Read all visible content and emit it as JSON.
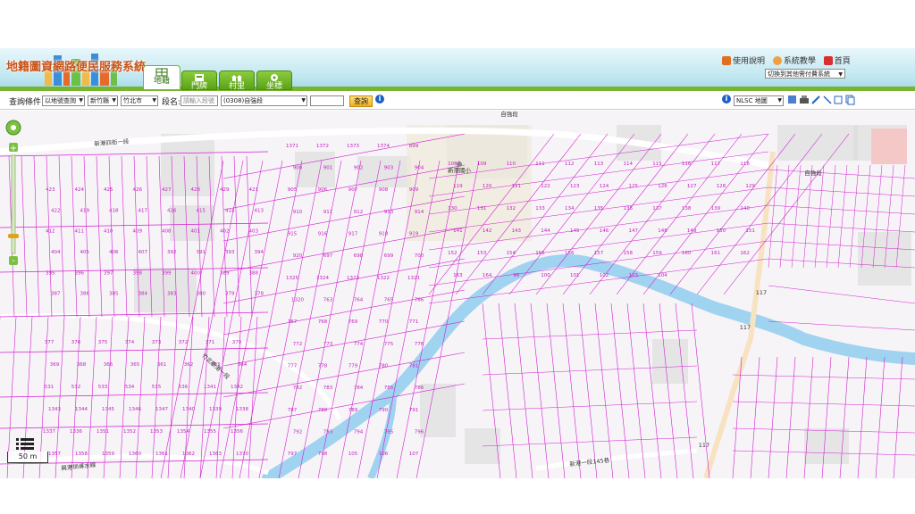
{
  "header": {
    "app_title": "地籍圖資網路便民服務系統",
    "tabs": [
      {
        "label": "地籍",
        "icon": "land-icon",
        "active": true
      },
      {
        "label": "門牌",
        "icon": "doorplate-icon",
        "active": false
      },
      {
        "label": "村里",
        "icon": "village-icon",
        "active": false
      },
      {
        "label": "坐標",
        "icon": "coordinate-icon",
        "active": false
      }
    ],
    "links": [
      {
        "label": "使用說明",
        "icon": "manual-icon"
      },
      {
        "label": "系統教學",
        "icon": "tutorial-icon"
      },
      {
        "label": "首頁",
        "icon": "home-icon"
      }
    ],
    "system_select": "切換到其他需付費系統"
  },
  "toolbar": {
    "query_condition_label": "查詢條件",
    "query_type": "以地號查詢",
    "county": "新竹縣",
    "township": "竹北市",
    "section_label": "段名:",
    "section_placeholder": "請輸入段號",
    "section_select": "(0308)自強段",
    "land_number": "",
    "query_button": "查詢",
    "basemap": "NLSC 地圖"
  },
  "map": {
    "scale_label": "50 m",
    "place_labels": [
      {
        "text": "新港國小",
        "kind": "school"
      },
      {
        "text": "竹北新港一段",
        "kind": "road"
      },
      {
        "text": "新港四街一段",
        "kind": "road"
      },
      {
        "text": "興港圳導水線",
        "kind": "canal"
      },
      {
        "text": "新港一段145巷",
        "kind": "road"
      },
      {
        "text": "117",
        "kind": "route"
      },
      {
        "text": "117",
        "kind": "route"
      },
      {
        "text": "117",
        "kind": "route"
      },
      {
        "text": "自強段",
        "kind": "section"
      },
      {
        "text": "自強段",
        "kind": "section"
      }
    ],
    "parcel_numbers": [
      "423",
      "424",
      "425",
      "426",
      "427",
      "428",
      "429",
      "421",
      "422",
      "419",
      "418",
      "417",
      "416",
      "415",
      "414",
      "413",
      "412",
      "411",
      "410",
      "409",
      "408",
      "401",
      "402",
      "403",
      "404",
      "405",
      "406",
      "407",
      "392",
      "391",
      "393",
      "394",
      "395",
      "396",
      "397",
      "398",
      "399",
      "400",
      "389",
      "388",
      "387",
      "386",
      "385",
      "384",
      "383",
      "380",
      "379",
      "378",
      "377",
      "376",
      "375",
      "374",
      "373",
      "372",
      "371",
      "370",
      "369",
      "368",
      "366",
      "365",
      "361",
      "362",
      "363",
      "364",
      "531",
      "532",
      "533",
      "534",
      "535",
      "536",
      "1341",
      "1342",
      "1343",
      "1344",
      "1345",
      "1346",
      "1347",
      "1340",
      "1339",
      "1338",
      "1337",
      "1336",
      "1351",
      "1352",
      "1353",
      "1354",
      "1355",
      "1356",
      "1357",
      "1358",
      "1359",
      "1360",
      "1361",
      "1362",
      "1363",
      "1370",
      "1371",
      "1372",
      "1373",
      "1374",
      "899",
      "900",
      "901",
      "902",
      "903",
      "904",
      "905",
      "906",
      "907",
      "908",
      "909",
      "910",
      "911",
      "912",
      "913",
      "914",
      "915",
      "916",
      "917",
      "918",
      "919",
      "920",
      "697",
      "698",
      "699",
      "700",
      "1325",
      "1324",
      "1323",
      "1322",
      "1321",
      "1320",
      "763",
      "764",
      "765",
      "766",
      "767",
      "768",
      "769",
      "770",
      "771",
      "772",
      "773",
      "774",
      "775",
      "776",
      "777",
      "778",
      "779",
      "780",
      "781",
      "782",
      "783",
      "784",
      "785",
      "786",
      "787",
      "788",
      "789",
      "790",
      "791",
      "792",
      "793",
      "794",
      "795",
      "796",
      "797",
      "798",
      "105",
      "106",
      "107",
      "108",
      "109",
      "110",
      "111",
      "112",
      "113",
      "114",
      "115",
      "116",
      "117",
      "118",
      "119",
      "120",
      "121",
      "122",
      "123",
      "124",
      "125",
      "126",
      "127",
      "128",
      "129",
      "130",
      "131",
      "132",
      "133",
      "134",
      "135",
      "136",
      "137",
      "138",
      "139",
      "140",
      "141",
      "142",
      "143",
      "144",
      "145",
      "146",
      "147",
      "148",
      "149",
      "150",
      "151",
      "152",
      "153",
      "154",
      "155",
      "156",
      "157",
      "158",
      "159",
      "160",
      "161",
      "162",
      "163",
      "164",
      "99",
      "100",
      "101",
      "102",
      "103",
      "104"
    ],
    "colors": {
      "parcel": "#d21fd2",
      "river": "#9fd3f0",
      "road": "#f2f0f0",
      "building": "#dadada"
    }
  }
}
